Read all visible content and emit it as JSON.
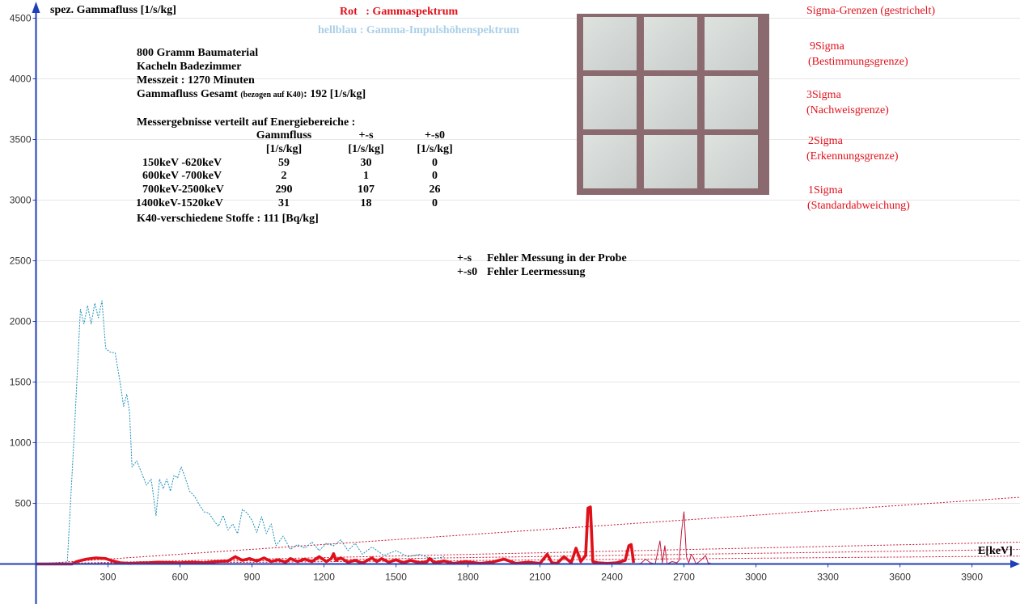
{
  "chart_data": {
    "type": "line",
    "ylabel": "spez. Gammafluss [1/s/kg]",
    "xlabel": "E[keV]",
    "xlim": [
      -150,
      4100
    ],
    "ylim": [
      -330,
      4650
    ],
    "x_ticks": [
      300,
      600,
      900,
      1200,
      1500,
      1800,
      2100,
      2400,
      2700,
      3000,
      3300,
      3600,
      3900
    ],
    "y_ticks": [
      500,
      1000,
      1500,
      2000,
      2500,
      3000,
      3500,
      4000,
      4500
    ],
    "legend": [
      {
        "label": "Rot   : Gammaspektrum",
        "color": "#e0101a"
      },
      {
        "label": "hellblau : Gamma-Impulshöhenspektrum",
        "color": "#a9cfe8"
      }
    ],
    "series": [
      {
        "color": "#1c8fb8",
        "style": "dashed",
        "x": [
          130,
          160,
          185,
          200,
          215,
          230,
          245,
          260,
          275,
          290,
          305,
          330,
          350,
          365,
          378,
          390,
          400,
          420,
          440,
          460,
          480,
          500,
          515,
          530,
          545,
          560,
          575,
          590,
          605,
          620,
          640,
          660,
          680,
          700,
          720,
          740,
          760,
          780,
          800,
          820,
          840,
          860,
          880,
          900,
          920,
          940,
          960,
          980,
          1000,
          1030,
          1060,
          1090,
          1120,
          1150,
          1180,
          1210,
          1240,
          1270,
          1300,
          1330,
          1360,
          1400,
          1450,
          1500,
          1550,
          1600,
          1650,
          1700
        ],
        "y": [
          0,
          1100,
          2100,
          1980,
          2130,
          1980,
          2150,
          2030,
          2170,
          1780,
          1750,
          1740,
          1500,
          1300,
          1400,
          1250,
          800,
          850,
          750,
          650,
          700,
          400,
          700,
          620,
          700,
          600,
          730,
          710,
          800,
          720,
          600,
          560,
          490,
          430,
          420,
          360,
          310,
          400,
          280,
          330,
          250,
          450,
          420,
          360,
          260,
          390,
          250,
          330,
          150,
          230,
          120,
          160,
          130,
          180,
          110,
          170,
          150,
          200,
          110,
          170,
          80,
          140,
          70,
          110,
          60,
          80,
          40,
          60
        ]
      },
      {
        "color": "#e0101a",
        "style": "solid-thick",
        "x": [
          0,
          150,
          170,
          210,
          250,
          290,
          320,
          350,
          390,
          430,
          470,
          510,
          550,
          600,
          650,
          700,
          750,
          800,
          830,
          860,
          890,
          920,
          950,
          980,
          1010,
          1040,
          1060,
          1090,
          1120,
          1150,
          1180,
          1210,
          1230,
          1240,
          1250,
          1270,
          1300,
          1330,
          1360,
          1400,
          1420,
          1440,
          1470,
          1500,
          1530,
          1560,
          1600,
          1630,
          1640,
          1660,
          1700,
          1740,
          1790,
          1850,
          1900,
          1950,
          2000,
          2050,
          2100,
          2130,
          2150,
          2170,
          2200,
          2230,
          2250,
          2270,
          2290,
          2300,
          2310,
          2320,
          2340,
          2380,
          2420,
          2455,
          2470,
          2480,
          2490
        ],
        "y": [
          0,
          0,
          20,
          40,
          50,
          45,
          25,
          10,
          5,
          8,
          10,
          15,
          12,
          10,
          15,
          10,
          20,
          25,
          60,
          30,
          45,
          25,
          50,
          20,
          35,
          15,
          45,
          20,
          40,
          20,
          60,
          20,
          45,
          85,
          30,
          50,
          15,
          30,
          8,
          50,
          20,
          45,
          15,
          35,
          10,
          30,
          10,
          20,
          45,
          10,
          25,
          5,
          20,
          5,
          15,
          40,
          5,
          15,
          5,
          80,
          10,
          5,
          60,
          10,
          130,
          20,
          70,
          460,
          470,
          20,
          10,
          5,
          10,
          30,
          150,
          160,
          10
        ]
      },
      {
        "color": "#c4193d",
        "style": "solid-thin",
        "x": [
          2490,
          2520,
          2540,
          2560,
          2580,
          2600,
          2610,
          2620,
          2630,
          2650,
          2670,
          2680,
          2690,
          2700,
          2710,
          2720,
          2730,
          2740,
          2750,
          2770,
          2790,
          2800,
          2820
        ],
        "y": [
          0,
          5,
          40,
          10,
          0,
          190,
          10,
          150,
          0,
          20,
          10,
          30,
          270,
          430,
          60,
          10,
          80,
          50,
          0,
          30,
          70,
          10,
          0
        ]
      }
    ],
    "sigma_lines": [
      {
        "name": "9Sigma",
        "y_start": 0,
        "y_end": 550
      },
      {
        "name": "3Sigma",
        "y_start": 0,
        "y_end": 180
      },
      {
        "name": "2Sigma",
        "y_start": 0,
        "y_end": 120
      },
      {
        "name": "1Sigma",
        "y_start": 0,
        "y_end": 65
      }
    ]
  },
  "legend_rot": "Rot   : Gammaspektrum",
  "legend_blue": "hellblau : Gamma-Impulshöhenspektrum",
  "sigma": {
    "title": "Sigma-Grenzen (gestrichelt)",
    "s9": "9Sigma",
    "s9_desc": "(Bestimmungsgrenze)",
    "s3": "3Sigma",
    "s3_desc": "(Nachweisgrenze)",
    "s2": "2Sigma",
    "s2_desc": "(Erkennungsgrenze)",
    "s1": "1Sigma",
    "s1_desc": "(Standardabweichung)"
  },
  "info": {
    "line1": "800 Gramm Baumaterial",
    "line2": "Kacheln Badezimmer",
    "line3": "Messzeit : 1270 Minuten",
    "line4_a": "Gammafluss Gesamt",
    "line4_b": "(bezogen auf K40)",
    "line4_c": ": 192 [1/s/kg]",
    "heading": "Messergebnisse verteilt auf  Energiebereiche :",
    "col_headers": [
      "",
      "Gammfluss",
      "+-s",
      "+-s0"
    ],
    "col_units": [
      "",
      "[1/s/kg]",
      "[1/s/kg]",
      "[1/s/kg]"
    ],
    "rows": [
      [
        "150keV -620keV",
        "59",
        "30",
        "0"
      ],
      [
        "600keV -700keV",
        "2",
        "1",
        "0"
      ],
      [
        "700keV-2500keV",
        "290",
        "107",
        "26"
      ],
      [
        "1400keV-1520keV",
        "31",
        "18",
        "0"
      ]
    ],
    "k40": "K40-verschiedene Stoffe : 111  [Bq/kg]"
  },
  "notes": {
    "s_key": "+-s",
    "s_text": "Fehler Messung in der Probe",
    "s0_key": "+-s0",
    "s0_text": "Fehler Leermessung"
  }
}
